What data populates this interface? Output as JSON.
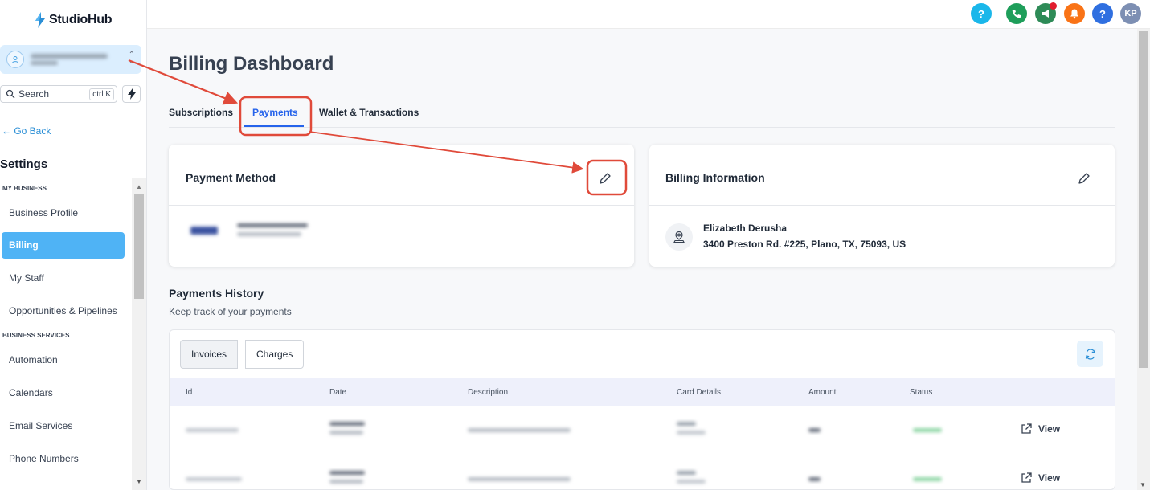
{
  "app": {
    "name": "StudioHub"
  },
  "sidebar": {
    "search_label": "Search",
    "search_shortcut": "ctrl K",
    "go_back": "← Go Back",
    "settings_title": "Settings",
    "sections": [
      {
        "title": "MY BUSINESS",
        "items": [
          "Business Profile",
          "Billing",
          "My Staff",
          "Opportunities & Pipelines"
        ]
      },
      {
        "title": "BUSINESS SERVICES",
        "items": [
          "Automation",
          "Calendars",
          "Email Services",
          "Phone Numbers"
        ]
      }
    ],
    "active_item": "Billing"
  },
  "topbar": {
    "help_label": "?",
    "help2_label": "?",
    "avatar_initials": "KP",
    "colors": {
      "help": "#1ab7ea",
      "phone": "#1e9e5a",
      "megaphone": "#2e8b57",
      "bell": "#f97316",
      "help2": "#2f6fe0",
      "avatar": "#7d8fb3"
    }
  },
  "page": {
    "title": "Billing Dashboard",
    "tabs": [
      "Subscriptions",
      "Payments",
      "Wallet & Transactions"
    ],
    "active_tab": "Payments"
  },
  "payment_method": {
    "title": "Payment Method"
  },
  "billing_info": {
    "title": "Billing Information",
    "name": "Elizabeth Derusha",
    "address": "3400 Preston Rd. #225, Plano, TX, 75093, US"
  },
  "payments_history": {
    "title": "Payments History",
    "subtitle": "Keep track of your payments",
    "segments": [
      "Invoices",
      "Charges"
    ],
    "columns": [
      "Id",
      "Date",
      "Description",
      "Card Details",
      "Amount",
      "Status"
    ],
    "view_label": "View"
  },
  "accent_color": "#2563eb",
  "annotation_color": "#e04a3a"
}
